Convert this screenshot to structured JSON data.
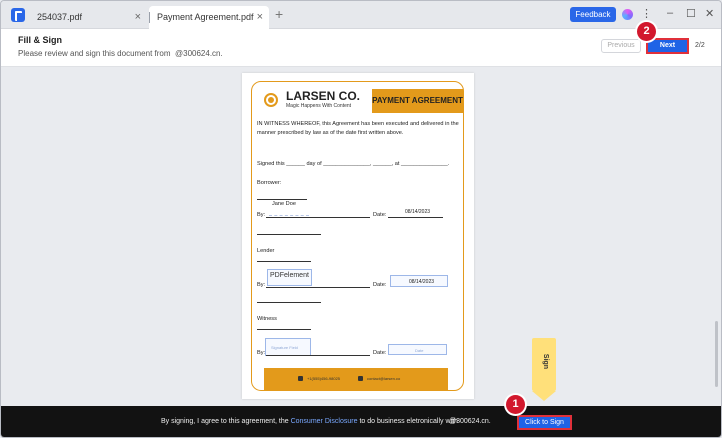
{
  "tabs": [
    {
      "label": "254037.pdf",
      "close": "×"
    },
    {
      "label": "Payment Agreement.pdf",
      "close": "×"
    }
  ],
  "new_tab": "+",
  "feedback_label": "Feedback",
  "kebab": "⋮",
  "window_controls": {
    "minimize": "–",
    "maximize": "☐",
    "close": "✕"
  },
  "toolbar": {
    "title": "Fill & Sign",
    "subtitle": "Please review and sign this document from",
    "email": "@300624.cn.",
    "previous": "Previous",
    "next": "Next",
    "page_count": "2/2"
  },
  "badges": {
    "one": "1",
    "two": "2"
  },
  "document": {
    "company": "LARSEN CO.",
    "tagline": "Magic Happens With Content",
    "heading": "PAYMENT AGREEMENT",
    "witness_paragraph": "IN WITNESS WHEREOF, this Agreement has been executed and delivered in the manner prescribed by law as of the date first written above.",
    "signed_line": "Signed this ______ day of _______________, ______, at _______________.",
    "borrower_label": "Borrower:",
    "borrower_name": "Jane Doe",
    "by_label": "By:",
    "date_label": "Date:",
    "borrower_date": "08/14/2023",
    "lender_label": "Lender",
    "lender_signature": "PDFelement",
    "lender_date": "08/14/2023",
    "witness_label": "Witness",
    "signature_placeholder": "Signature Field",
    "date_placeholder": "Date",
    "footer_phone": "+1(555)456-98025",
    "footer_email": "contact@larsen.co"
  },
  "sign_tab_label": "Sign",
  "bottom": {
    "text_before": "By signing, I agree to this agreement, the ",
    "link": "Consumer Disclosure",
    "text_after": " to do business eletronically with",
    "email": "@300624.cn.",
    "button": "Click to Sign"
  }
}
